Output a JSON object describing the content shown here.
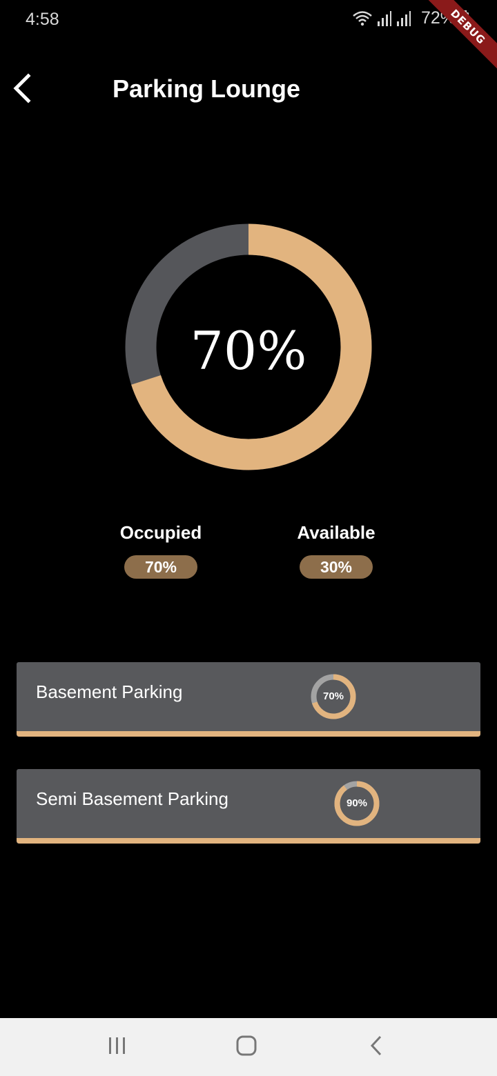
{
  "status_bar": {
    "time": "4:58",
    "battery": "72%",
    "icons": [
      "wifi-icon",
      "signal-icon",
      "signal-icon",
      "battery-icon"
    ]
  },
  "debug_banner": "DEBUG",
  "app_bar": {
    "title": "Parking Lounge",
    "back_icon": "chevron-left-icon"
  },
  "overview": {
    "value_label": "70%",
    "occupied_fraction": 0.7,
    "occupied_color": "#e2b47f",
    "available_color": "#55565a"
  },
  "legend": {
    "occupied_label": "Occupied",
    "occupied_value": "70%",
    "available_label": "Available",
    "available_value": "30%"
  },
  "areas": [
    {
      "name": "Basement Parking",
      "value_label": "70%",
      "occupied_fraction": 0.7
    },
    {
      "name": "Semi Basement Parking",
      "value_label": "90%",
      "occupied_fraction": 0.9
    }
  ],
  "colors": {
    "background": "#000000",
    "accent": "#e2b47f",
    "card": "#58595c",
    "pill": "#8d6e4b",
    "mini_remaining": "#a3a3a3"
  },
  "nav_bar": {
    "icons": [
      "recents-icon",
      "home-icon",
      "back-icon"
    ]
  }
}
